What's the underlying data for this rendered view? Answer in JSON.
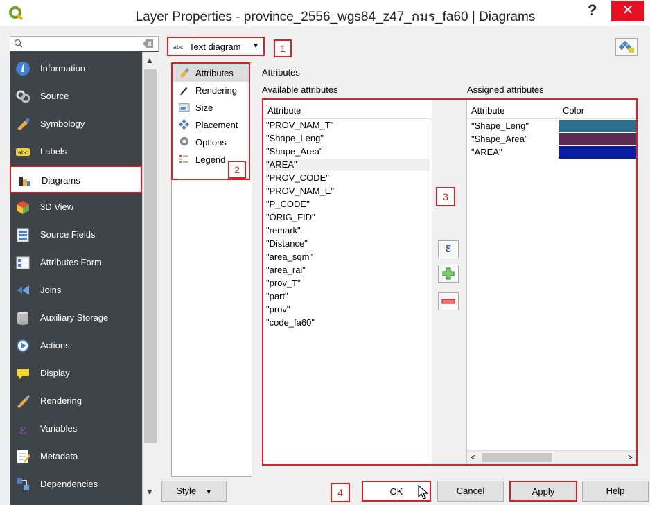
{
  "window": {
    "title": "Layer Properties - province_2556_wgs84_z47_กมร_fa60 | Diagrams",
    "help_glyph": "?",
    "close_glyph": "✕"
  },
  "sidebar": {
    "search_placeholder": "",
    "items": [
      {
        "label": "Information",
        "icon": "info-icon"
      },
      {
        "label": "Source",
        "icon": "source-icon"
      },
      {
        "label": "Symbology",
        "icon": "symbology-icon"
      },
      {
        "label": "Labels",
        "icon": "labels-icon"
      },
      {
        "label": "Diagrams",
        "icon": "diagrams-icon",
        "active": true
      },
      {
        "label": "3D View",
        "icon": "cube-icon"
      },
      {
        "label": "Source Fields",
        "icon": "fields-icon"
      },
      {
        "label": "Attributes Form",
        "icon": "form-icon"
      },
      {
        "label": "Joins",
        "icon": "joins-icon"
      },
      {
        "label": "Auxiliary Storage",
        "icon": "database-icon"
      },
      {
        "label": "Actions",
        "icon": "actions-icon"
      },
      {
        "label": "Display",
        "icon": "display-icon"
      },
      {
        "label": "Rendering",
        "icon": "brush-icon"
      },
      {
        "label": "Variables",
        "icon": "variables-icon"
      },
      {
        "label": "Metadata",
        "icon": "metadata-icon"
      },
      {
        "label": "Dependencies",
        "icon": "dependencies-icon"
      }
    ]
  },
  "diagram_type": {
    "abc": "abc",
    "value": "Text diagram"
  },
  "annotations": [
    "1",
    "2",
    "3",
    "4"
  ],
  "sections": [
    {
      "label": "Attributes",
      "icon": "attributes-icon",
      "selected": true
    },
    {
      "label": "Rendering",
      "icon": "pen-icon"
    },
    {
      "label": "Size",
      "icon": "size-icon"
    },
    {
      "label": "Placement",
      "icon": "placement-icon"
    },
    {
      "label": "Options",
      "icon": "options-icon"
    },
    {
      "label": "Legend",
      "icon": "legend-icon"
    }
  ],
  "attributes": {
    "heading": "Attributes",
    "available_heading": "Available attributes",
    "assigned_heading": "Assigned attributes",
    "available_column": "Attribute",
    "available": [
      "\"PROV_NAM_T\"",
      "\"Shape_Leng\"",
      "\"Shape_Area\"",
      "\"AREA\"",
      "\"PROV_CODE\"",
      "\"PROV_NAM_E\"",
      "\"P_CODE\"",
      "\"ORIG_FID\"",
      "\"remark\"",
      "\"Distance\"",
      "\"area_sqm\"",
      "\"area_rai\"",
      "\"prov_T\"",
      "\"part\"",
      "\"prov\"",
      "\"code_fa60\""
    ],
    "assigned_columns": [
      "Attribute",
      "Color"
    ],
    "assigned": [
      {
        "name": "\"Shape_Leng\"",
        "color": "#2e6e8e"
      },
      {
        "name": "\"Shape_Area\"",
        "color": "#5a2a52"
      },
      {
        "name": "\"AREA\"",
        "color": "#0a1fa0"
      }
    ]
  },
  "buttons": {
    "style": "Style",
    "ok": "OK",
    "cancel": "Cancel",
    "apply": "Apply",
    "help": "Help"
  }
}
